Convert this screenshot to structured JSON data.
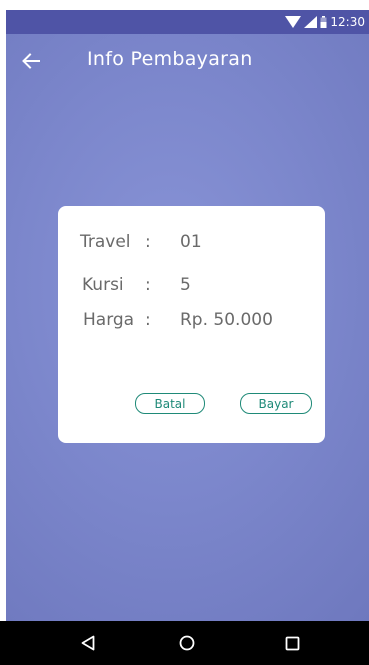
{
  "status_bar": {
    "time": "12:30",
    "icons": [
      "wifi-icon",
      "cell-signal-icon",
      "battery-icon"
    ]
  },
  "app_bar": {
    "title": "Info Pembayaran",
    "back_icon": "arrow-left-icon"
  },
  "payment_card": {
    "rows": [
      {
        "label": "Travel",
        "separator": ":",
        "value": "01"
      },
      {
        "label": "Kursi",
        "separator": ":",
        "value": "5"
      },
      {
        "label": "Harga",
        "separator": ":",
        "value": "Rp. 50.000"
      }
    ],
    "cancel_label": "Batal",
    "pay_label": "Bayar"
  },
  "nav_bar": {
    "icons": [
      "back-triangle-icon",
      "home-circle-icon",
      "recents-square-icon"
    ]
  },
  "colors": {
    "status_bar": "#4f54a6",
    "background": "#7c87cc",
    "accent": "#1f8a78",
    "card": "#ffffff",
    "text": "#6a6a6a"
  }
}
